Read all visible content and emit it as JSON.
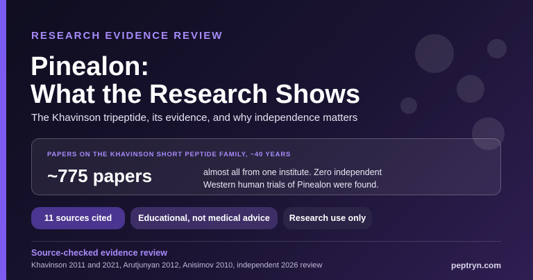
{
  "eyebrow": "RESEARCH EVIDENCE REVIEW",
  "title": {
    "line1": "Pinealon:",
    "line2": "What the Research Shows"
  },
  "subtitle": "The Khavinson tripeptide, its evidence, and why independence matters",
  "stat_card": {
    "label": "PAPERS ON THE KHAVINSON SHORT PEPTIDE FAMILY, ~40 YEARS",
    "value": "~775 papers",
    "description_line1": "almost all from one institute. Zero independent",
    "description_line2": "Western human trials of Pinealon were found."
  },
  "badges": [
    {
      "label": "11 sources cited"
    },
    {
      "label": "Educational, not medical advice"
    },
    {
      "label": "Research use only"
    }
  ],
  "footer": {
    "title": "Source-checked evidence review",
    "sources": "Khavinson 2011 and 2021, Arutjunyan 2012, Anisimov 2010, independent 2026 review",
    "brand": "peptryn.com"
  },
  "colors": {
    "accent": "#7c5cf0",
    "eyebrow_text": "#a78bfa",
    "background_dark": "#0f0d1f",
    "background_light": "#2f1e52"
  }
}
